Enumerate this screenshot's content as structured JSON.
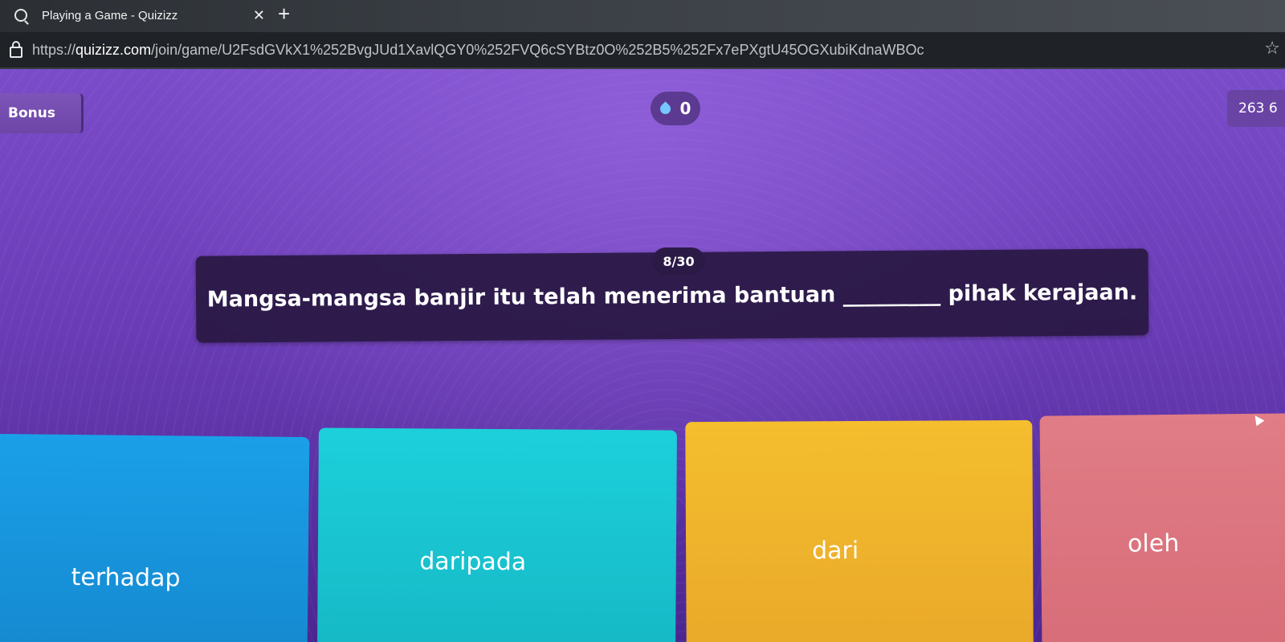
{
  "browser": {
    "tab_title": "Playing a Game - Quizizz",
    "tab_close": "✕",
    "new_tab": "+",
    "url_scheme": "https://",
    "url_domain": "quizizz.com",
    "url_path": "/join/game/U2FsdGVkX1%252BvgJUd1XavlQGY0%252FVQ6cSYBtz0O%252B5%252Fx7ePXgtU45OGXubiKdnaWBOc",
    "star": "☆"
  },
  "game": {
    "bonus_label": "Bonus",
    "streak_count": "0",
    "score": "263  6",
    "progress": "8/30",
    "question": "Mangsa-mangsa banjir itu telah menerima bantuan _________ pihak kerajaan.",
    "options": [
      {
        "label": "terhadap",
        "color": "#1a9ce4"
      },
      {
        "label": "daripada",
        "color": "#1cc9d5"
      },
      {
        "label": "dari",
        "color": "#f2b82d"
      },
      {
        "label": "oleh",
        "color": "#dd7782"
      }
    ]
  },
  "icons": {
    "favicon": "search-icon",
    "lock": "lock-icon",
    "bookmark": "star-icon",
    "streak": "drop-icon"
  }
}
